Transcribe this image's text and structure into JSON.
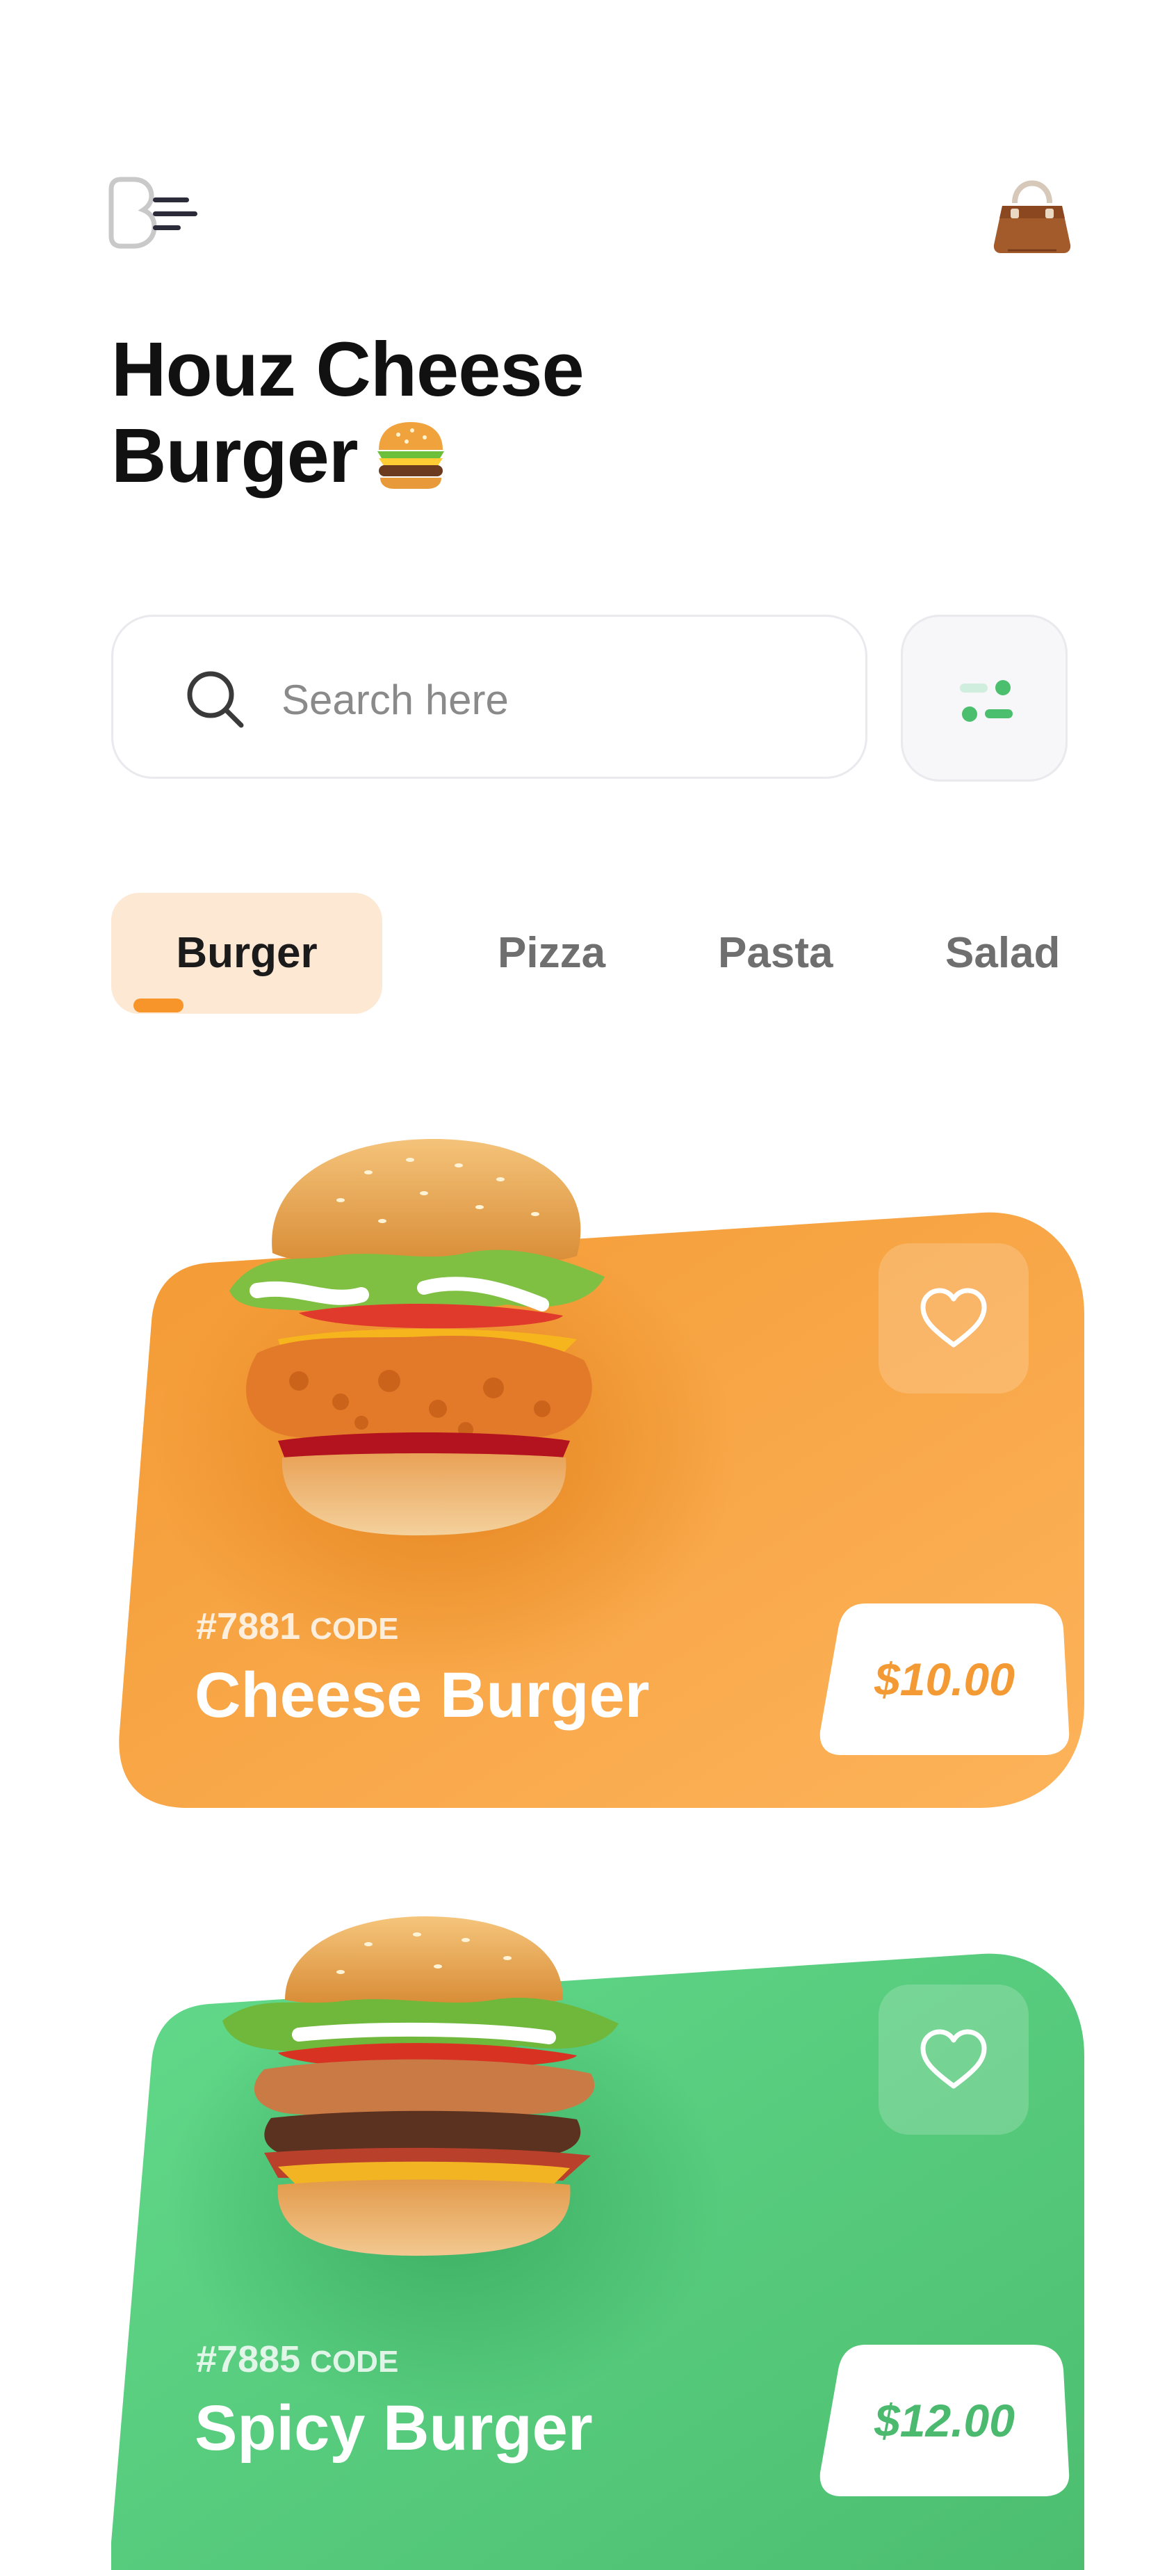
{
  "header": {
    "logo_icon": "brand-menu-logo-icon",
    "cart_icon": "shopping-bag-icon"
  },
  "title": {
    "line1": "Houz Cheese",
    "line2": "Burger",
    "emoji_icon": "hamburger-emoji-icon"
  },
  "search": {
    "placeholder": "Search here",
    "value": "",
    "icon": "search-icon",
    "filter_icon": "filter-icon",
    "accent": "#4cbf6e"
  },
  "categories": {
    "active_index": 0,
    "items": [
      {
        "label": "Burger"
      },
      {
        "label": "Pizza"
      },
      {
        "label": "Pasta"
      },
      {
        "label": "Salad"
      }
    ],
    "active_bg": "#fde8d4",
    "indicator_color": "#f7942a"
  },
  "products": [
    {
      "code_number": "#7881",
      "code_label": "CODE",
      "name": "Cheese Burger",
      "price": "$10.00",
      "card_color": "#f9a54a",
      "price_color": "#f39a35",
      "favorite_icon": "heart-outline-icon"
    },
    {
      "code_number": "#7885",
      "code_label": "CODE",
      "name": "Spicy Burger",
      "price": "$12.00",
      "card_color": "#57cd7d",
      "price_color": "#4bb96e",
      "favorite_icon": "heart-outline-icon"
    }
  ]
}
